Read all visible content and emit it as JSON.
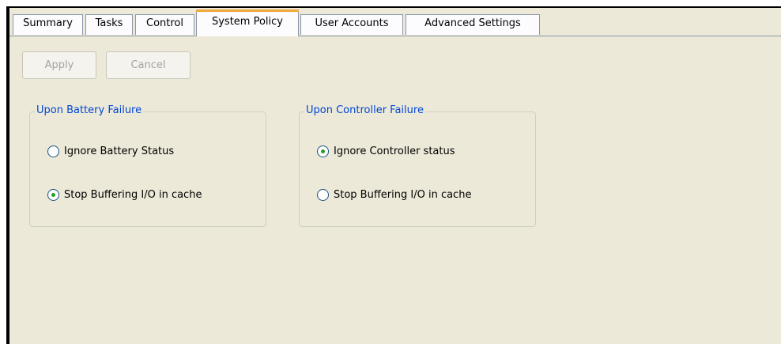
{
  "tabs": [
    {
      "label": "Summary",
      "active": false
    },
    {
      "label": "Tasks",
      "active": false
    },
    {
      "label": "Control",
      "active": false
    },
    {
      "label": "System Policy",
      "active": true
    },
    {
      "label": "User Accounts",
      "active": false
    },
    {
      "label": "Advanced Settings",
      "active": false
    }
  ],
  "toolbar": {
    "apply_label": "Apply",
    "cancel_label": "Cancel"
  },
  "groups": {
    "battery": {
      "title": "Upon Battery Failure",
      "options": [
        {
          "label": "Ignore Battery Status",
          "checked": false
        },
        {
          "label": "Stop Buffering I/O in cache",
          "checked": true
        }
      ]
    },
    "controller": {
      "title": "Upon Controller Failure",
      "options": [
        {
          "label": "Ignore Controller status",
          "checked": true
        },
        {
          "label": "Stop Buffering I/O in cache",
          "checked": false
        }
      ]
    }
  },
  "colors": {
    "panel_background": "#ece9d8",
    "legend_text": "#0046d5",
    "active_tab_accent": "#f2a93b",
    "radio_dot": "#21a121",
    "disabled_text": "#a3a3a3"
  }
}
